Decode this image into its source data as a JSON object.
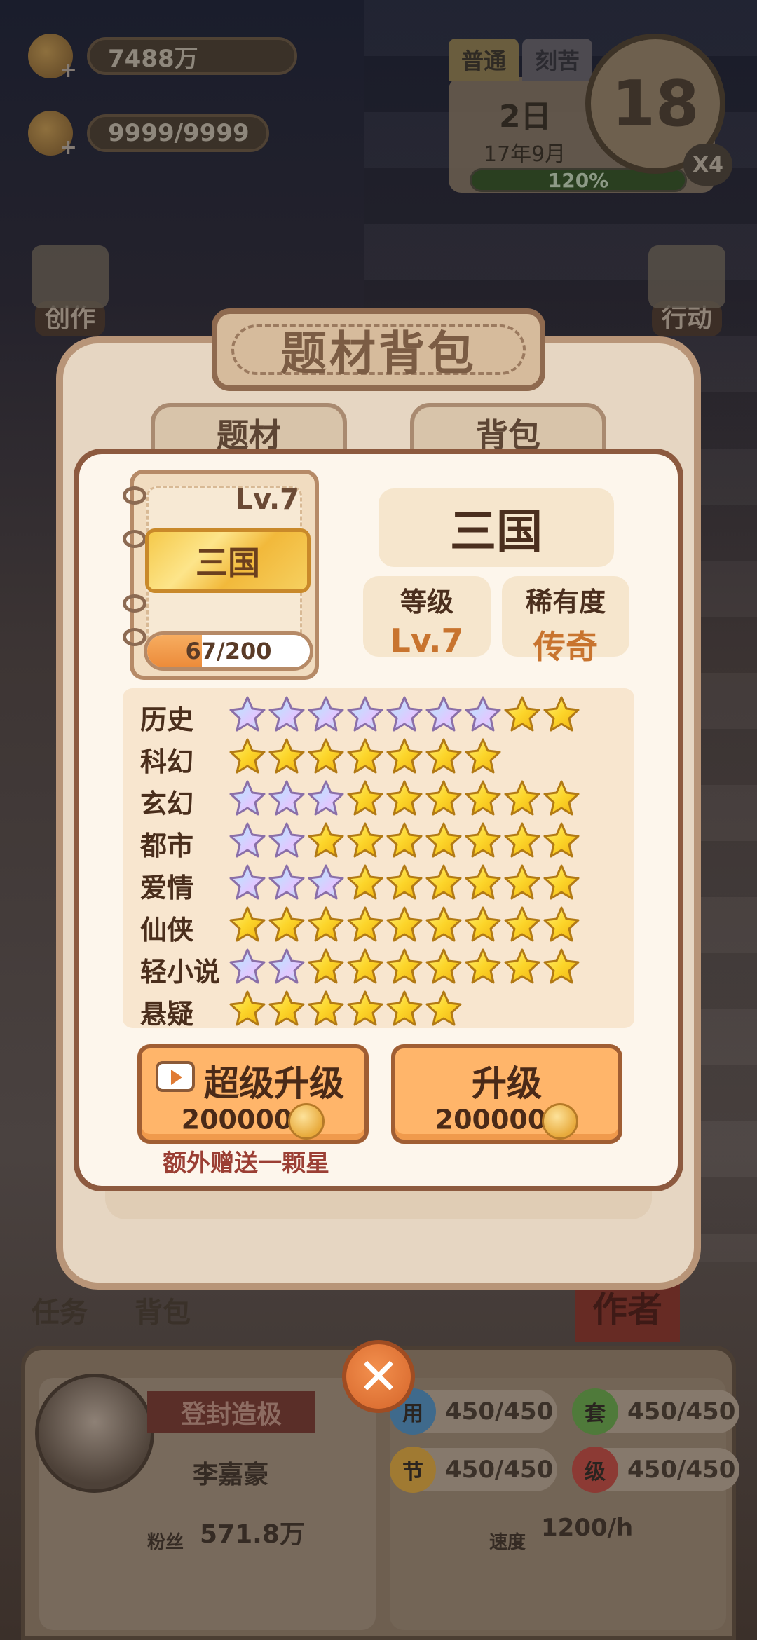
{
  "hud": {
    "coins": "7488万",
    "ideas": "9999/9999",
    "mode_normal": "普通",
    "mode_hard": "刻苦",
    "day": "2日",
    "month": "17年9月",
    "energy": "120%",
    "energy_level": 1.2,
    "timer": "18",
    "speed": "X4",
    "create_label": "创作",
    "action_label": "行动",
    "task_label": "任务",
    "bag_label": "背包",
    "author_label": "作者"
  },
  "profile": {
    "title": "登封造极",
    "name": "李嘉豪",
    "fans_label": "粉丝",
    "fans_value": "571.8万",
    "speed_label": "速度",
    "speed_value": "1200/h",
    "stats": [
      {
        "icon": "用",
        "value": "450/450",
        "color": "#3f6a8c"
      },
      {
        "icon": "套",
        "value": "450/450",
        "color": "#4f7a3a"
      },
      {
        "icon": "节",
        "value": "450/450",
        "color": "#a07a32"
      },
      {
        "icon": "级",
        "value": "450/450",
        "color": "#8c3a34"
      }
    ]
  },
  "modal": {
    "title": "题材背包",
    "tab_topics": "题材",
    "tab_bag": "背包",
    "topic_level": "Lv.7",
    "topic_name": "三国",
    "progress_text": "67/200",
    "progress_fraction": 0.335,
    "level_key": "等级",
    "level_value": "Lv.7",
    "rarity_key": "稀有度",
    "rarity_value": "传奇",
    "genres": [
      {
        "name": "历史",
        "stars": [
          "rainbow",
          "rainbow",
          "rainbow",
          "rainbow",
          "rainbow",
          "rainbow",
          "rainbow",
          "gold",
          "gold"
        ]
      },
      {
        "name": "科幻",
        "stars": [
          "gold",
          "gold",
          "gold",
          "gold",
          "gold",
          "gold",
          "gold"
        ]
      },
      {
        "name": "玄幻",
        "stars": [
          "rainbow",
          "rainbow",
          "rainbow",
          "gold",
          "gold",
          "gold",
          "gold",
          "gold",
          "gold"
        ]
      },
      {
        "name": "都市",
        "stars": [
          "rainbow",
          "rainbow",
          "gold",
          "gold",
          "gold",
          "gold",
          "gold",
          "gold",
          "gold"
        ]
      },
      {
        "name": "爱情",
        "stars": [
          "rainbow",
          "rainbow",
          "rainbow",
          "gold",
          "gold",
          "gold",
          "gold",
          "gold",
          "gold"
        ]
      },
      {
        "name": "仙侠",
        "stars": [
          "gold",
          "gold",
          "gold",
          "gold",
          "gold",
          "gold",
          "gold",
          "gold",
          "gold"
        ]
      },
      {
        "name": "轻小说",
        "stars": [
          "rainbow",
          "rainbow",
          "gold",
          "gold",
          "gold",
          "gold",
          "gold",
          "gold",
          "gold"
        ]
      },
      {
        "name": "悬疑",
        "stars": [
          "gold",
          "gold",
          "gold",
          "gold",
          "gold",
          "gold"
        ]
      }
    ],
    "super_upgrade_label": "超级升级",
    "super_upgrade_cost": "200000",
    "upgrade_label": "升级",
    "upgrade_cost": "200000",
    "bonus_text": "额外赠送一颗星"
  }
}
